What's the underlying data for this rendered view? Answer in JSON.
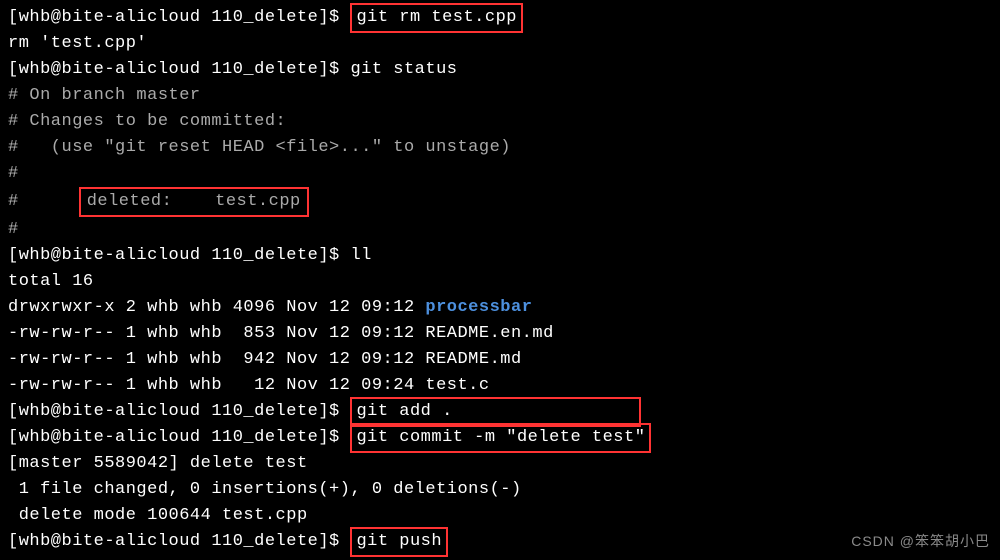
{
  "prompt1": "[whb@bite-alicloud 110_delete]$ ",
  "cmd1": "git rm test.cpp",
  "out1": "rm 'test.cpp'",
  "prompt2": "[whb@bite-alicloud 110_delete]$ ",
  "cmd2": "git status",
  "status1": "# On branch master",
  "status2": "# Changes to be committed:",
  "status3": "#   (use \"git reset HEAD <file>...\" to unstage)",
  "status4": "#",
  "status5a": "#",
  "status5box": "deleted:    test.cpp",
  "status6": "#",
  "prompt3": "[whb@bite-alicloud 110_delete]$ ",
  "cmd3": "ll",
  "ll1": "total 16",
  "ll2a": "drwxrwxr-x 2 whb whb 4096 Nov 12 09:12 ",
  "ll2b": "processbar",
  "ll3": "-rw-rw-r-- 1 whb whb  853 Nov 12 09:12 README.en.md",
  "ll4": "-rw-rw-r-- 1 whb whb  942 Nov 12 09:12 README.md",
  "ll5": "-rw-rw-r-- 1 whb whb   12 Nov 12 09:24 test.c",
  "prompt4": "[whb@bite-alicloud 110_delete]$ ",
  "cmd4": "git add .",
  "cmd4pad": "                 ",
  "prompt5": "[whb@bite-alicloud 110_delete]$ ",
  "cmd5": "git commit -m \"delete test\"",
  "commit1": "[master 5589042] delete test",
  "commit2": " 1 file changed, 0 insertions(+), 0 deletions(-)",
  "commit3": " delete mode 100644 test.cpp",
  "prompt6": "[whb@bite-alicloud 110_delete]$ ",
  "cmd6": "git push",
  "watermark": "CSDN @笨笨胡小巴"
}
